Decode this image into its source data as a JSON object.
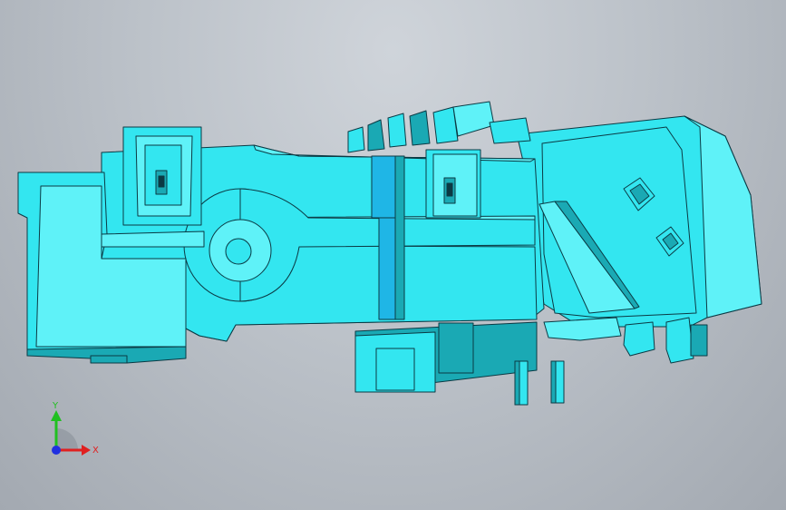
{
  "viewport": {
    "background_top": "#cfd4da",
    "background_bottom": "#a3a9b1"
  },
  "model": {
    "face_color": "#33e6f0",
    "face_light": "#5ff2f8",
    "face_dark": "#1aa9b4",
    "edge_color": "#0b3a44"
  },
  "triad": {
    "y_label": "Y",
    "x_label": "X",
    "x_color": "#e02020",
    "y_color": "#20c020",
    "z_color": "#2030e0"
  }
}
